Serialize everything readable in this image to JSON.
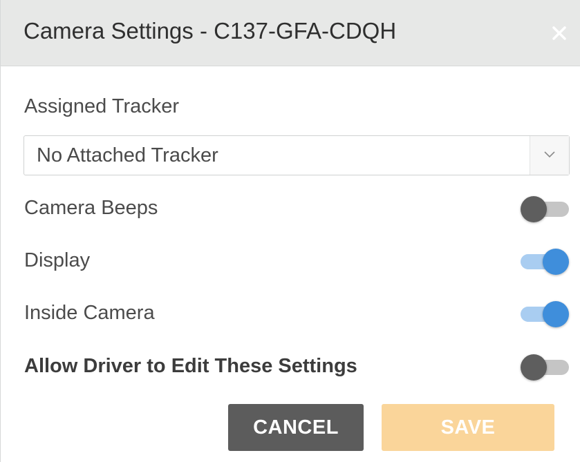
{
  "dialog": {
    "title": "Camera Settings - C137-GFA-CDQH",
    "close_label": "×"
  },
  "tracker": {
    "label": "Assigned Tracker",
    "selected_value": "No Attached Tracker"
  },
  "settings": [
    {
      "label": "Camera Beeps",
      "enabled": false
    },
    {
      "label": "Display",
      "enabled": true
    },
    {
      "label": "Inside Camera",
      "enabled": true
    },
    {
      "label": "Allow Driver to Edit These Settings",
      "enabled": false
    }
  ],
  "buttons": {
    "cancel_label": "CANCEL",
    "save_label": "SAVE"
  },
  "colors": {
    "header_bg": "#e7e8e7",
    "toggle_on": "#3f8edb",
    "toggle_off": "#5e5e5e",
    "cancel_bg": "#5c5c5c",
    "save_bg": "#fad59a"
  }
}
